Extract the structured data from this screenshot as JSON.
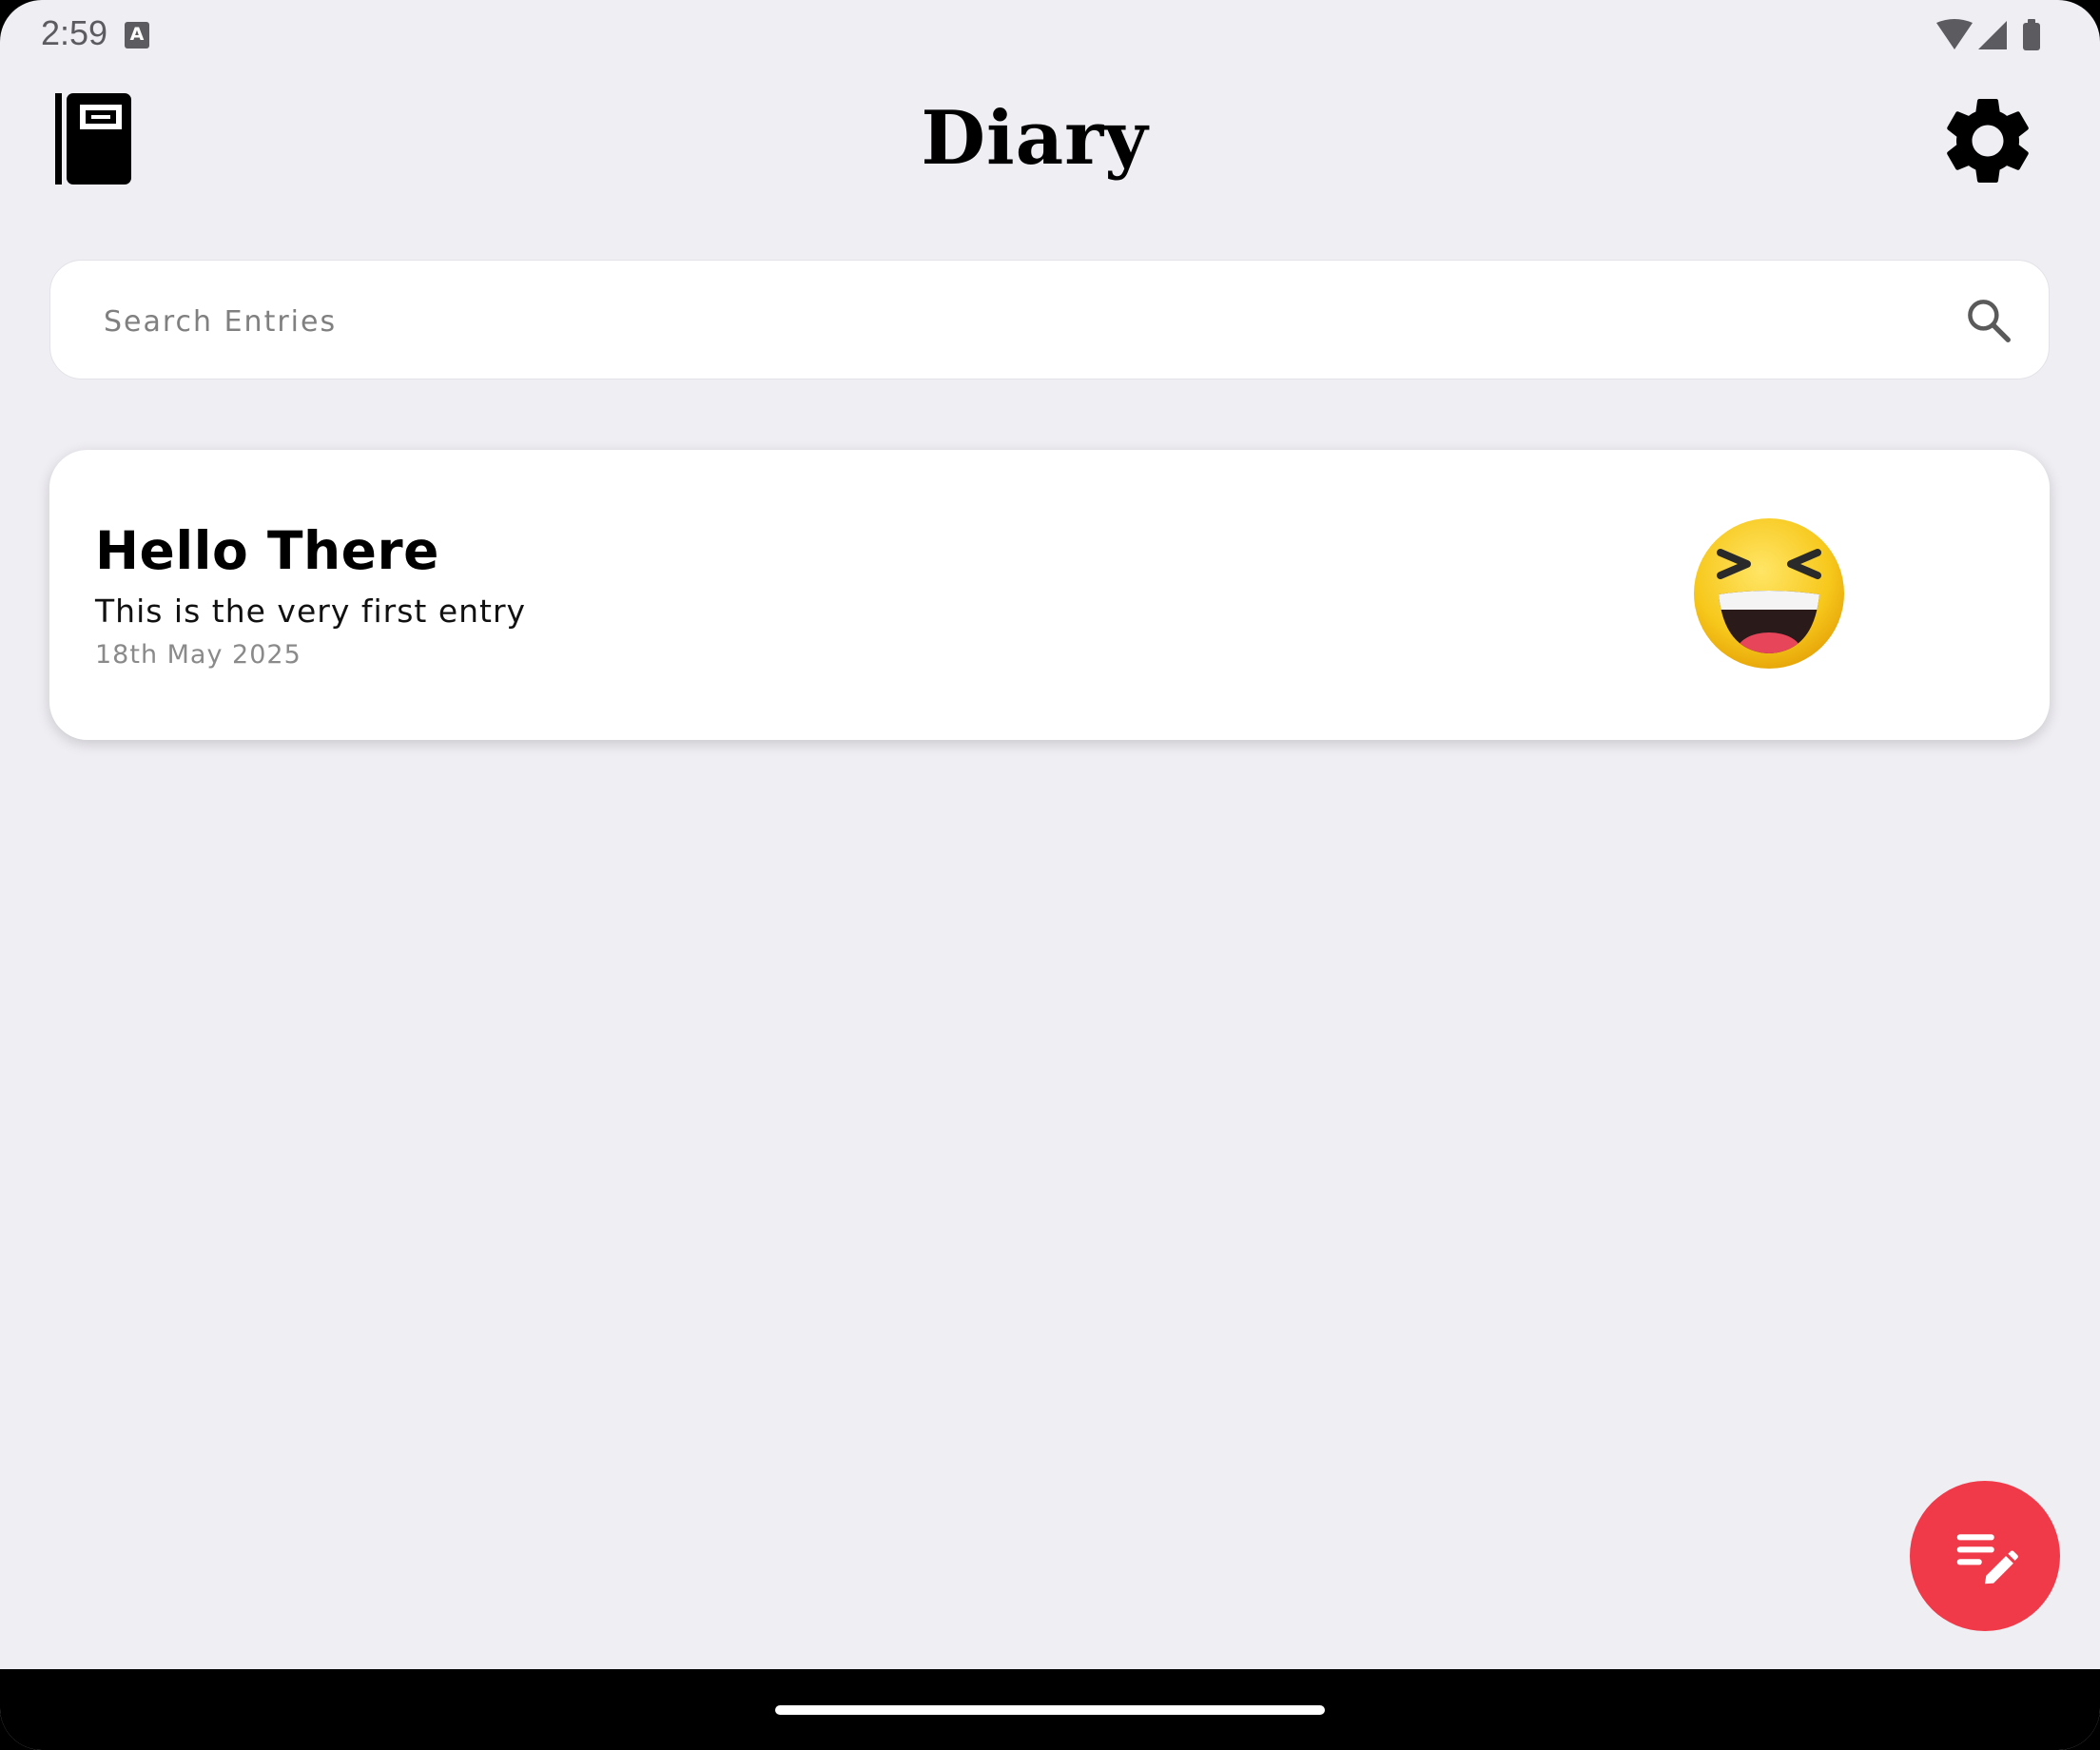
{
  "status_bar": {
    "time": "2:59",
    "notification_icon": "A",
    "icons": [
      "wifi-icon",
      "cell-signal-icon",
      "battery-icon"
    ]
  },
  "header": {
    "title": "Diary",
    "logo_icon": "notebook-icon",
    "settings_icon": "gear-icon"
  },
  "search": {
    "placeholder": "Search Entries",
    "value": "",
    "icon": "search-icon"
  },
  "entries": [
    {
      "title": "Hello There",
      "body": "This is the very first entry",
      "date": "18th May 2025",
      "mood_icon": "laughing-face-emoji"
    }
  ],
  "fab": {
    "icon": "edit-note-icon",
    "color": "#f03a4a"
  },
  "colors": {
    "background": "#efeef3",
    "card": "#ffffff",
    "accent": "#f03a4a"
  }
}
